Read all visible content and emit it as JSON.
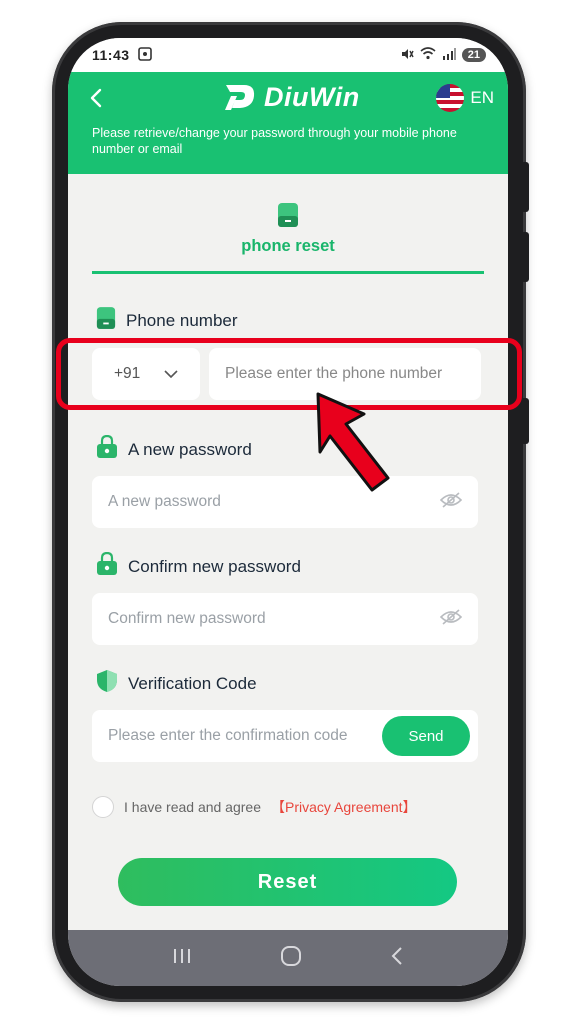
{
  "status_bar": {
    "time": "11:43",
    "battery": "21"
  },
  "header": {
    "logo_text": "DiuWin",
    "language": "EN",
    "description": "Please retrieve/change your password through your mobile phone number or email"
  },
  "tab": {
    "label": "phone reset"
  },
  "phone": {
    "label": "Phone number",
    "country_code": "+91",
    "placeholder": "Please enter the phone number"
  },
  "new_password": {
    "label": "A new password",
    "placeholder": "A new password"
  },
  "confirm_password": {
    "label": "Confirm new password",
    "placeholder": "Confirm new password"
  },
  "verification": {
    "label": "Verification Code",
    "placeholder": "Please enter the confirmation code",
    "send_label": "Send"
  },
  "agreement": {
    "text": "I have read and agree",
    "link": "【Privacy Agreement】"
  },
  "reset_label": "Reset",
  "colors": {
    "brand": "#19c172",
    "accent_red": "#e8001c",
    "link": "#e8463c"
  }
}
